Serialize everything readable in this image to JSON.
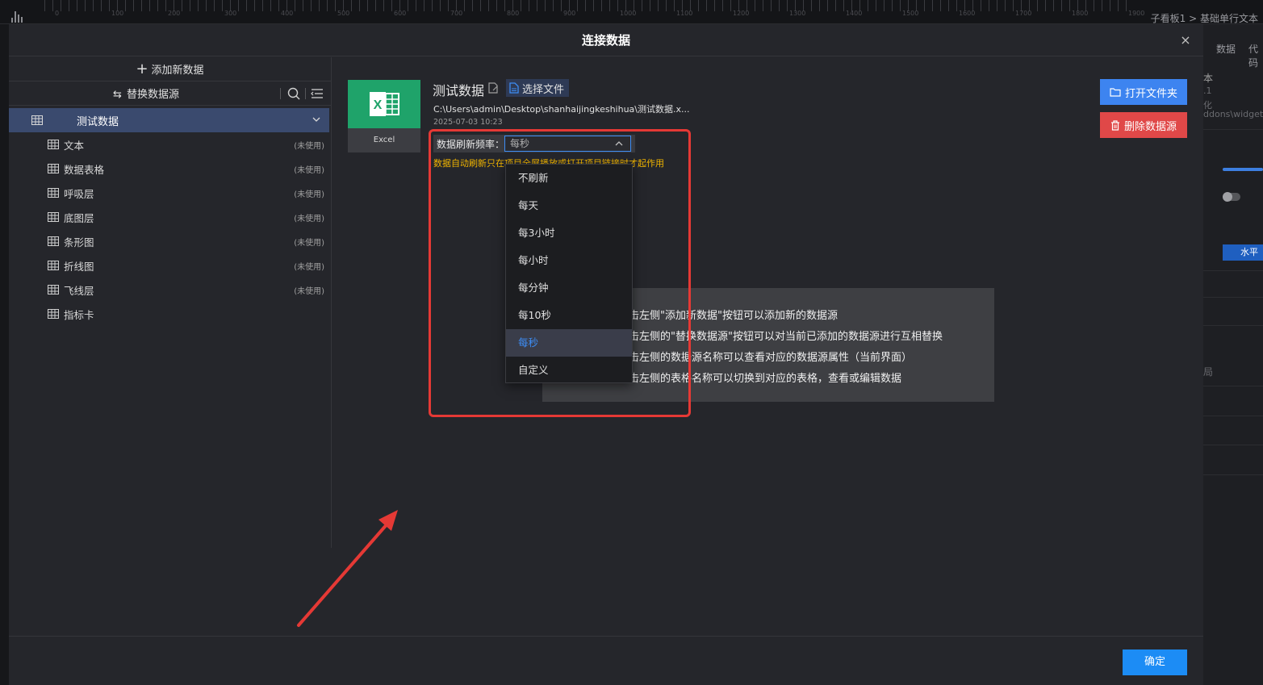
{
  "background": {
    "ruler_numbers": [
      "0",
      "100",
      "200",
      "300",
      "400",
      "500",
      "600",
      "700",
      "800",
      "900",
      "1000",
      "1100",
      "1200",
      "1300",
      "1400",
      "1500",
      "1600",
      "1700",
      "1800",
      "1900"
    ],
    "breadcrumb": "子看板1 > 基础单行文本",
    "right_panel": {
      "tab_data": "数据",
      "tab_code": "代码",
      "text_1": "本",
      "text_2": ".1",
      "text_3": "化",
      "text_4": "ddons\\widgets",
      "blue_btn": "水平",
      "text_5": "局"
    }
  },
  "modal": {
    "title": "连接数据",
    "close_label": "×"
  },
  "sidebar": {
    "add_label": "添加新数据",
    "replace_label": "替换数据源",
    "datasource": "测试数据",
    "tables": [
      {
        "label": "文本",
        "status": "(未使用)"
      },
      {
        "label": "数据表格",
        "status": "(未使用)"
      },
      {
        "label": "呼吸层",
        "status": "(未使用)"
      },
      {
        "label": "底图层",
        "status": "(未使用)"
      },
      {
        "label": "条形图",
        "status": "(未使用)"
      },
      {
        "label": "折线图",
        "status": "(未使用)"
      },
      {
        "label": "飞线层",
        "status": "(未使用)"
      },
      {
        "label": "指标卡",
        "status": ""
      }
    ]
  },
  "detail": {
    "excel_label": "Excel",
    "name": "测试数据",
    "choose_file": "选择文件",
    "path": "C:\\Users\\admin\\Desktop\\shanhaijingkeshihua\\测试数据.x...",
    "date": "2025-07-03 10:23",
    "freq_label": "数据刷新频率：",
    "freq_value": "每秒",
    "warning": "数据自动刷新只在项目全屏播放或打开项目链接时才起作用",
    "open_folder": "打开文件夹",
    "delete_ds": "删除数据源"
  },
  "dropdown": {
    "options": [
      "不刷新",
      "每天",
      "每3小时",
      "每小时",
      "每分钟",
      "每10秒",
      "每秒",
      "自定义"
    ],
    "selected_index": 6
  },
  "info": {
    "lines": [
      "点击左侧\"添加新数据\"按钮可以添加新的数据源",
      "点击左侧的\"替换数据源\"按钮可以对当前已添加的数据源进行互相替换",
      "点击左侧的数据源名称可以查看对应的数据源属性（当前界面）",
      "点击左侧的表格名称可以切换到对应的表格，查看或编辑数据"
    ]
  },
  "footer": {
    "ok_label": "确定"
  },
  "colors": {
    "accent": "#3d8df5",
    "excel_green": "#1fa36a",
    "danger": "#e04848",
    "warning": "#f0b400",
    "annotation": "#e53935"
  }
}
